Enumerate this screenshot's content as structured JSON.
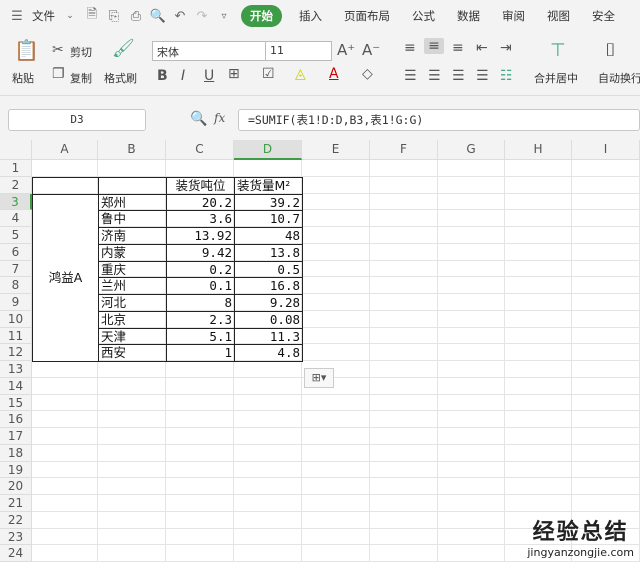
{
  "tabbar": {
    "file": "文件",
    "active_tab": "开始",
    "tabs": [
      "插入",
      "页面布局",
      "公式",
      "数据",
      "审阅",
      "视图",
      "安全"
    ]
  },
  "ribbon": {
    "paste": "粘贴",
    "cut": "剪切",
    "copy": "复制",
    "format_painter": "格式刷",
    "font_name": "宋体",
    "font_size": "11",
    "merge_center": "合并居中",
    "wrap_text": "自动换行"
  },
  "formula_bar": {
    "name_box": "D3",
    "fx": "fx",
    "formula": "=SUMIF(表1!D:D,B3,表1!G:G)"
  },
  "sheet": {
    "columns": [
      "A",
      "B",
      "C",
      "D",
      "E",
      "F",
      "G",
      "H",
      "I"
    ],
    "selected_cell": "D3",
    "row_count": 24,
    "header_c": "装货吨位",
    "header_d": "装货量M²",
    "group_label": "鸿益A",
    "rows": [
      {
        "city": "郑州",
        "c": "20.2",
        "d": "39.2"
      },
      {
        "city": "鲁中",
        "c": "3.6",
        "d": "10.7"
      },
      {
        "city": "济南",
        "c": "13.92",
        "d": "48"
      },
      {
        "city": "内蒙",
        "c": "9.42",
        "d": "13.8"
      },
      {
        "city": "重庆",
        "c": "0.2",
        "d": "0.5"
      },
      {
        "city": "兰州",
        "c": "0.1",
        "d": "16.8"
      },
      {
        "city": "河北",
        "c": "8",
        "d": "9.28"
      },
      {
        "city": "北京",
        "c": "2.3",
        "d": "0.08"
      },
      {
        "city": "天津",
        "c": "5.1",
        "d": "11.3"
      },
      {
        "city": "西安",
        "c": "1",
        "d": "4.8"
      }
    ]
  },
  "watermark": {
    "title": "经验总结",
    "url": "jingyanzongjie.com"
  }
}
